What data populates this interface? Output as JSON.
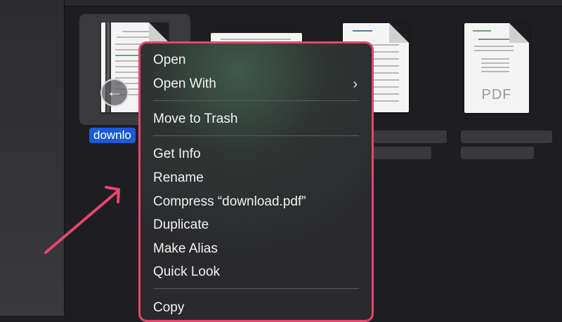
{
  "files": {
    "selected_name": "downlo",
    "pdf_badge": "PDF"
  },
  "context_menu": {
    "items": [
      {
        "label": "Open"
      },
      {
        "label": "Open With",
        "has_submenu": true
      },
      {
        "label": "Move to Trash"
      },
      {
        "label": "Get Info"
      },
      {
        "label": "Rename"
      },
      {
        "label": "Compress “download.pdf”"
      },
      {
        "label": "Duplicate"
      },
      {
        "label": "Make Alias"
      },
      {
        "label": "Quick Look"
      },
      {
        "label": "Copy"
      }
    ],
    "submenu_indicator": "›"
  },
  "colors": {
    "highlight_border": "#e8456f",
    "selection_blue": "#1a5bd6",
    "arrow": "#e8456f"
  },
  "icons": {
    "back": "←"
  }
}
